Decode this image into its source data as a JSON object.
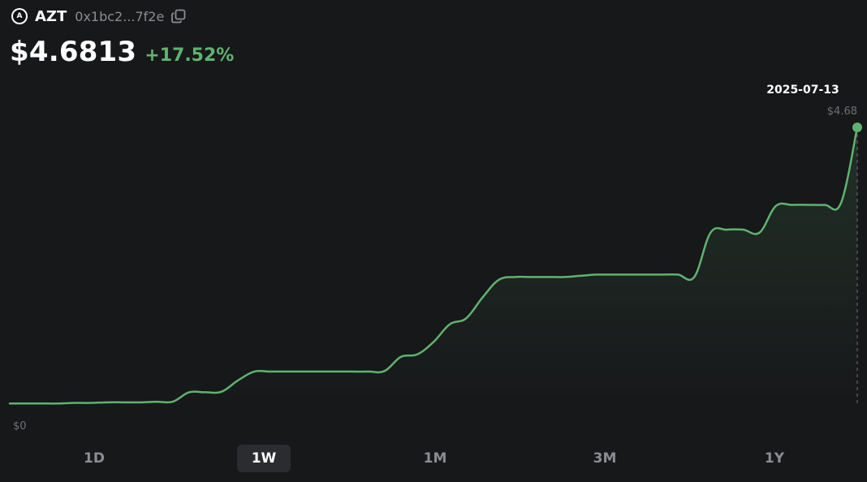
{
  "token": {
    "logo_letter": "A",
    "symbol": "AZT",
    "address": "0x1bc2...7f2e"
  },
  "price": {
    "value": "$4.6813",
    "change": "+17.52%"
  },
  "colors": {
    "background": "#17181a",
    "line": "#5fb36f",
    "positive": "#5fb36f",
    "muted": "#8b8d91"
  },
  "chart_data": {
    "type": "line",
    "x": [
      "t0",
      "t1",
      "t2",
      "t3",
      "t4",
      "t5",
      "t6",
      "t7",
      "t8",
      "t9",
      "t10",
      "t11",
      "t12",
      "t13",
      "t14",
      "t15",
      "t16",
      "t17",
      "t18",
      "t19",
      "t20",
      "t21",
      "t22",
      "t23",
      "t24",
      "t25",
      "t26",
      "t27",
      "t28",
      "t29",
      "t30",
      "t31",
      "t32",
      "t33",
      "t34",
      "t35",
      "t36",
      "t37",
      "t38",
      "t39",
      "t40",
      "t41",
      "t42",
      "t43",
      "t44",
      "t45",
      "t46",
      "t47",
      "t48",
      "t49",
      "t50",
      "t51",
      "t52"
    ],
    "values": [
      0.01,
      0.01,
      0.01,
      0.01,
      0.02,
      0.02,
      0.03,
      0.03,
      0.03,
      0.04,
      0.04,
      0.2,
      0.2,
      0.21,
      0.4,
      0.55,
      0.55,
      0.55,
      0.55,
      0.55,
      0.55,
      0.55,
      0.55,
      0.56,
      0.8,
      0.84,
      1.05,
      1.35,
      1.45,
      1.8,
      2.1,
      2.15,
      2.15,
      2.15,
      2.15,
      2.17,
      2.19,
      2.19,
      2.19,
      2.19,
      2.19,
      2.19,
      2.15,
      2.9,
      2.95,
      2.95,
      2.9,
      3.35,
      3.37,
      3.37,
      3.37,
      3.4,
      4.68
    ],
    "ylim": [
      0,
      4.68
    ],
    "y_min_label": "$0",
    "last_point": {
      "date": "2025-07-13",
      "value_label": "$4.68"
    },
    "grid": false,
    "legend": "none"
  },
  "ranges": {
    "items": [
      "1D",
      "1W",
      "1M",
      "3M",
      "1Y"
    ],
    "active": "1W"
  }
}
